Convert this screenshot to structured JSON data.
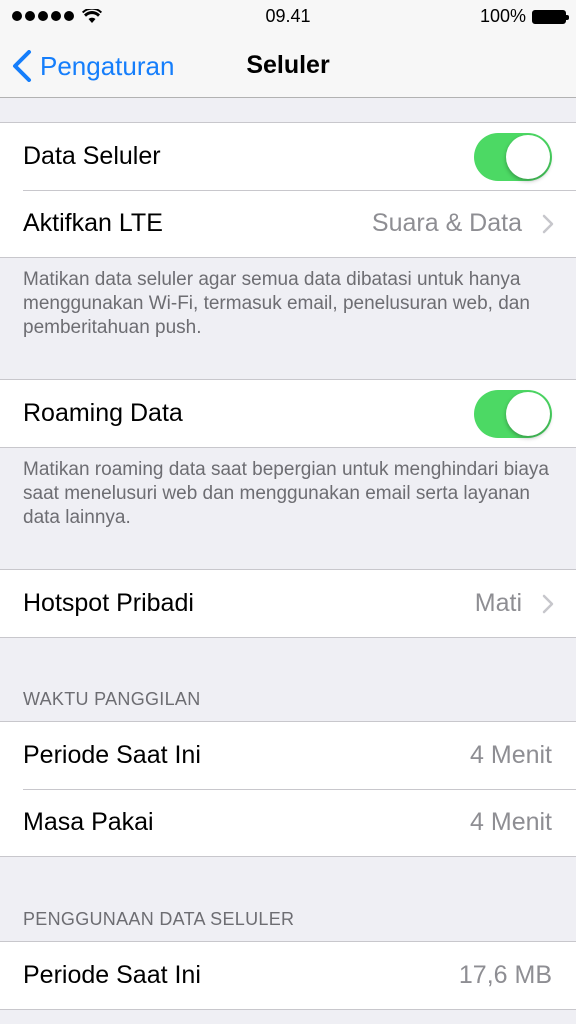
{
  "status_bar": {
    "time": "09.41",
    "battery": "100%"
  },
  "nav": {
    "back_label": "Pengaturan",
    "title": "Seluler"
  },
  "group1": {
    "data_seluler": {
      "label": "Data Seluler",
      "on": true
    },
    "lte": {
      "label": "Aktifkan LTE",
      "value": "Suara & Data"
    },
    "footer": "Matikan data seluler agar semua data dibatasi untuk hanya menggunakan Wi-Fi, termasuk email, penelusuran web, dan pemberitahuan push."
  },
  "group2": {
    "roaming": {
      "label": "Roaming Data",
      "on": true
    },
    "footer": "Matikan roaming data saat bepergian untuk menghindari biaya saat menelusuri web dan menggunakan email serta layanan data lainnya."
  },
  "group3": {
    "hotspot": {
      "label": "Hotspot Pribadi",
      "value": "Mati"
    }
  },
  "call_time": {
    "header": "WAKTU PANGGILAN",
    "current": {
      "label": "Periode Saat Ini",
      "value": "4 Menit"
    },
    "lifetime": {
      "label": "Masa Pakai",
      "value": "4 Menit"
    }
  },
  "data_usage": {
    "header": "PENGGUNAAN DATA SELULER",
    "current": {
      "label": "Periode Saat Ini",
      "value": "17,6 MB"
    }
  },
  "colors": {
    "accent": "#157efb",
    "toggle_on": "#4cd964"
  }
}
